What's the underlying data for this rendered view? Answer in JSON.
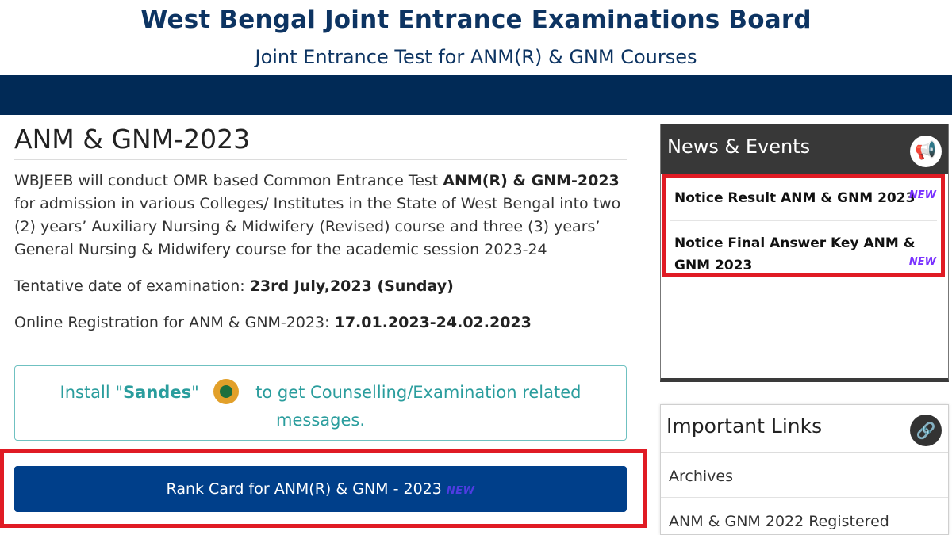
{
  "header": {
    "title": "West Bengal Joint Entrance Examinations Board",
    "subtitle": "Joint Entrance Test for ANM(R) & GNM Courses"
  },
  "main": {
    "page_title": "ANM & GNM-2023",
    "intro_a": "WBJEEB will conduct OMR based Common Entrance Test ",
    "intro_bold": "ANM(R) & GNM-2023",
    "intro_b": " for admission in various Colleges/ Institutes in the State of West Bengal into two (2) years’ Auxiliary Nursing & Midwifery (Revised) course and three (3) years’ General Nursing & Midwifery course for the academic session 2023-24",
    "exam_date_label": "Tentative date of examination: ",
    "exam_date_value": "23rd July,2023 (Sunday)",
    "registration_label": "Online Registration for ANM & GNM-2023: ",
    "registration_value": "17.01.2023-24.02.2023",
    "sandes": {
      "prefix": "Install \"",
      "app_name": "Sandes",
      "quote_close": "\"",
      "suffix": "to get Counselling/Examination related",
      "line2": "messages."
    },
    "rank_button": {
      "label": "Rank Card for ANM(R) & GNM - 2023",
      "badge": "NEW"
    }
  },
  "news": {
    "heading": "News & Events",
    "icon": "megaphone-icon",
    "items": [
      {
        "label": "Notice Result ANM & GNM 2023",
        "badge": "NEW"
      },
      {
        "label": "Notice Final Answer Key ANM & GNM 2023",
        "badge": "NEW"
      }
    ]
  },
  "links": {
    "heading": "Important Links",
    "icon": "link-icon",
    "items": [
      {
        "label": "Archives"
      },
      {
        "label": "ANM & GNM 2022 Registered"
      }
    ]
  },
  "colors": {
    "navbar": "#012a56",
    "title_text": "#0d3462",
    "button": "#003f8a",
    "highlight": "#e01b24",
    "sandes_text": "#2a9d9d"
  }
}
